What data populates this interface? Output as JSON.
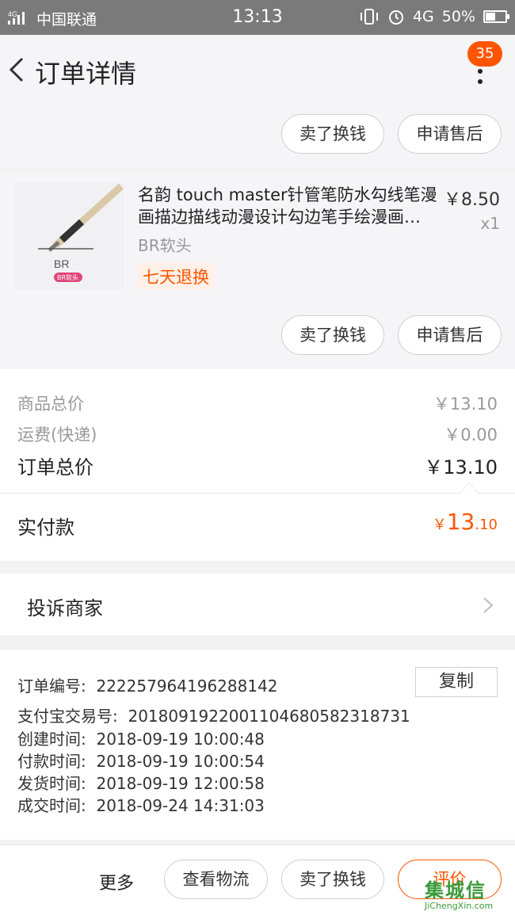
{
  "status_bar": {
    "network": "4G",
    "carrier": "中国联通",
    "time": "13:13",
    "net_type": "4G",
    "battery": "50%",
    "battery_level": 0.5
  },
  "header": {
    "title": "订单详情",
    "badge": "35"
  },
  "top_actions": {
    "sell_label": "卖了换钱",
    "aftersale_label": "申请售后"
  },
  "item": {
    "title": "名韵 touch master针管笔防水勾线笔漫画描边描线动漫设计勾边笔手绘漫画…",
    "sku": "BR软头",
    "tag": "七天退换",
    "price": "￥8.50",
    "qty": "x1",
    "thumb_text": "BR",
    "thumb_badge": "BR软头",
    "sell_label": "卖了换钱",
    "aftersale_label": "申请售后"
  },
  "summary": {
    "goods_total_label": "商品总价",
    "goods_total": "￥13.10",
    "shipping_label": "运费(快递)",
    "shipping": "￥0.00",
    "order_total_label": "订单总价",
    "order_total": "￥13.10",
    "paid_label": "实付款",
    "paid_currency": "￥",
    "paid_int": "13",
    "paid_dec": ".10"
  },
  "complain": {
    "label": "投诉商家"
  },
  "order_info": {
    "order_no_label": "订单编号:",
    "order_no": "222257964196288142",
    "copy_label": "复制",
    "alipay_label": "支付宝交易号:",
    "alipay_no": "2018091922001104680582318731",
    "created_label": "创建时间:",
    "created": "2018-09-19 10:00:48",
    "paid_label": "付款时间:",
    "paid": "2018-09-19 10:00:54",
    "shipped_label": "发货时间:",
    "shipped": "2018-09-19 12:00:58",
    "done_label": "成交时间:",
    "done": "2018-09-24 14:31:03"
  },
  "bottom_bar": {
    "more_label": "更多",
    "logistics_label": "查看物流",
    "sell_label": "卖了换钱",
    "review_label": "评价"
  },
  "watermark": {
    "cn": "集城信",
    "en": "JiChengXin.com"
  },
  "colors": {
    "accent": "#ff5500",
    "status_bar": "#7a7a7a",
    "watermark": "#3a9a3a"
  }
}
